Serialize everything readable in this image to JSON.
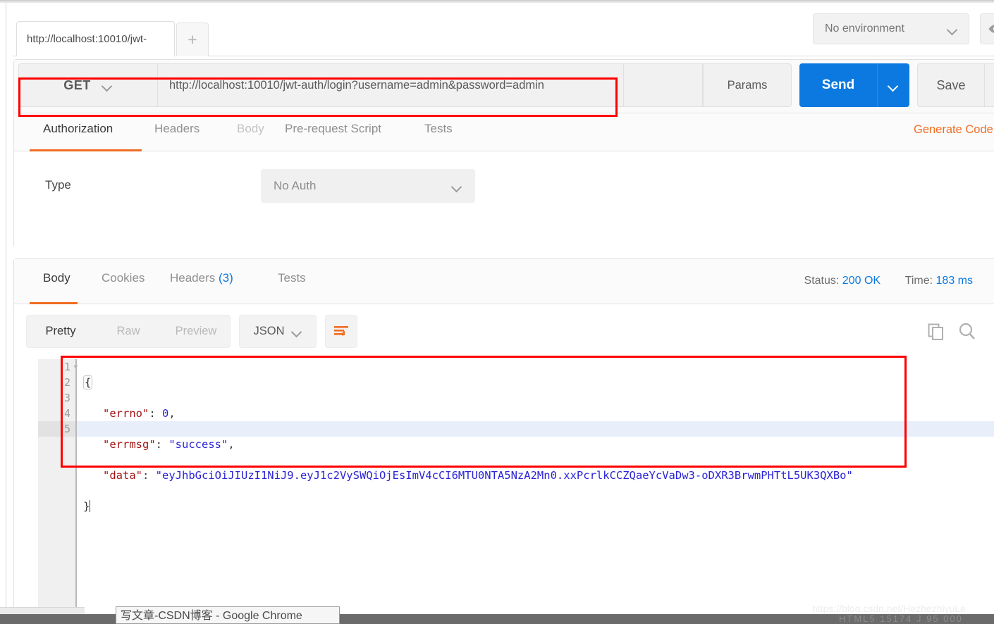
{
  "window": {
    "tab_title": "http://localhost:10010/jwt-",
    "new_tab_label": "+",
    "environment_label": "No environment",
    "eye_icon": "eye-icon"
  },
  "request": {
    "method": "GET",
    "url": "http://localhost:10010/jwt-auth/login?username=admin&password=admin",
    "params_label": "Params",
    "send_label": "Send",
    "save_label": "Save",
    "generate_code_label": "Generate Code",
    "tabs": [
      {
        "label": "Authorization",
        "state": "active"
      },
      {
        "label": "Headers",
        "state": "normal"
      },
      {
        "label": "Body",
        "state": "disabled"
      },
      {
        "label": "Pre-request Script",
        "state": "normal"
      },
      {
        "label": "Tests",
        "state": "normal"
      }
    ],
    "auth": {
      "type_label": "Type",
      "type_value": "No Auth"
    }
  },
  "response": {
    "tabs": [
      {
        "label": "Body",
        "state": "active",
        "count": ""
      },
      {
        "label": "Cookies",
        "state": "normal",
        "count": ""
      },
      {
        "label": "Headers",
        "state": "normal",
        "count": "(3)"
      },
      {
        "label": "Tests",
        "state": "normal",
        "count": ""
      }
    ],
    "status_label": "Status:",
    "status_value": "200 OK",
    "time_label": "Time:",
    "time_value": "183 ms",
    "view_modes": [
      "Pretty",
      "Raw",
      "Preview"
    ],
    "active_view_mode": "Pretty",
    "format": "JSON",
    "wrap_icon": "word-wrap-icon",
    "copy_icon": "copy-icon",
    "search_icon": "search-icon",
    "line_numbers": [
      "1",
      "2",
      "3",
      "4",
      "5"
    ],
    "active_line": 5,
    "body_json": {
      "errno": 0,
      "errmsg": "success",
      "data": "eyJhbGciOiJIUzI1NiJ9.eyJ1c2VySWQiOjEsImV4cCI6MTU0NTA5NzA2Mn0.xxPcrlkCCZQaeYcVaDw3-oDXR3BrwmPHTtL5UK3QXBo"
    },
    "code_lines": [
      {
        "num": "1",
        "text": "{"
      },
      {
        "num": "2",
        "text": "    \"errno\": 0,"
      },
      {
        "num": "3",
        "text": "    \"errmsg\": \"success\","
      },
      {
        "num": "4",
        "text": "    \"data\": \"eyJhbGciOiJIUzI1NiJ9.eyJ1c2VySWQiOjEsImV4cCI6MTU0NTA5NzA2Mn0.xxPcrlkCCZQaeYcVaDw3-oDXR3BrwmPHTtL5UK3QXBo\""
      },
      {
        "num": "5",
        "text": "}"
      }
    ],
    "code_parts": {
      "line2_key": "\"errno\"",
      "line2_val": "0",
      "line3_key": "\"errmsg\"",
      "line3_val": "\"success\"",
      "line4_key": "\"data\"",
      "line4_val": "\"eyJhbGciOiJIUzI1NiJ9.eyJ1c2VySWQiOjEsImV4cCI6MTU0NTA5NzA2Mn0.xxPcrlkCCZQaeYcVaDw3-oDXR3BrwmPHTtL5UK3QXBo\"",
      "open_brace": "{",
      "close_brace": "}",
      "colon": ": ",
      "comma": ","
    }
  },
  "desktop": {
    "tooltip_text": "写文章-CSDN博客 - Google Chrome",
    "watermark_text": "https://blog.csdn.net/HezhezhiyuLe",
    "taskbar_ghost": "HTML5  15174  J 95   000"
  },
  "colors": {
    "accent_orange": "#f26c21",
    "link_blue": "#0c79e0",
    "annotation_red": "#ff0000",
    "panel_gray": "#f1f1f1"
  }
}
